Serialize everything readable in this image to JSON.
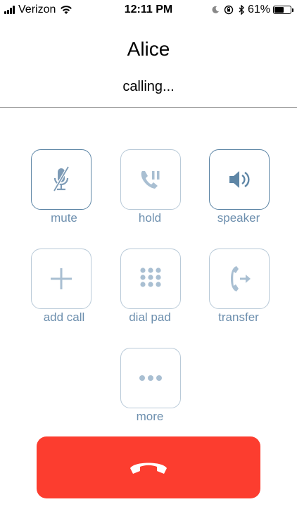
{
  "status_bar": {
    "carrier": "Verizon",
    "time": "12:11 PM",
    "battery_percent": "61%",
    "battery_level": 0.61
  },
  "call": {
    "contact_name": "Alice",
    "status": "calling..."
  },
  "controls": [
    {
      "label": "mute",
      "icon": "mic-muted-icon",
      "active": true
    },
    {
      "label": "hold",
      "icon": "hold-icon",
      "active": false
    },
    {
      "label": "speaker",
      "icon": "speaker-icon",
      "active": true
    },
    {
      "label": "add call",
      "icon": "plus-icon",
      "active": false
    },
    {
      "label": "dial pad",
      "icon": "dial-pad-icon",
      "active": false
    },
    {
      "label": "transfer",
      "icon": "transfer-icon",
      "active": false
    },
    {
      "label": "more",
      "icon": "more-icon",
      "active": false
    }
  ],
  "colors": {
    "end_call": "#fc3d2f",
    "control_border": "#b9cad8",
    "control_border_active": "#5e86a6",
    "label": "#6d8fae",
    "icon": "#a9bfd2",
    "icon_active": "#5e86a6"
  }
}
